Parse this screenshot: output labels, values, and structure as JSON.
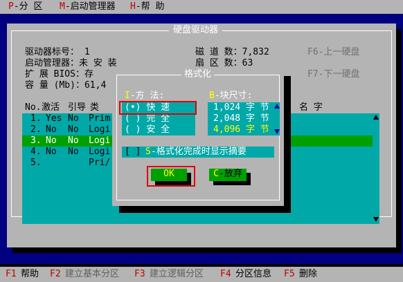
{
  "menu": {
    "items": [
      {
        "key": "P",
        "label": "-分  区"
      },
      {
        "key": "M",
        "label": "-启动管理器"
      },
      {
        "key": "H",
        "label": "-帮  助"
      }
    ]
  },
  "main_window": {
    "title": "硬盘驱动器",
    "info_left": [
      {
        "label": "驱动器标号",
        "value": "：  1"
      },
      {
        "label": "启动管理器",
        "value": "：未  安  装"
      },
      {
        "label": "扩 展 BIOS",
        "value": "：存"
      },
      {
        "label": "容 量 (Mb)",
        "value": "：61,4"
      }
    ],
    "info_right": [
      {
        "label": "磁 道 数",
        "value": "：7,832"
      },
      {
        "label": "扇 区 数",
        "value": "：63"
      }
    ],
    "buttons": [
      {
        "key": "F6",
        "label": "-上一硬盘"
      },
      {
        "key": "F7",
        "label": "-下一硬盘"
      }
    ],
    "table": {
      "headers": [
        "No.",
        "激活",
        "引导",
        "类",
        "名  字"
      ],
      "rows": [
        {
          "no": "1.",
          "active": "Yes",
          "boot": "No",
          "type": "Prim"
        },
        {
          "no": "2.",
          "active": "No",
          "boot": "No",
          "type": "Logi"
        },
        {
          "no": "3.",
          "active": "No",
          "boot": "No",
          "type": "Logi"
        },
        {
          "no": "4.",
          "active": "No",
          "boot": "No",
          "type": "Logi"
        },
        {
          "no": "5.",
          "active": "",
          "boot": "",
          "type": "Pri/"
        }
      ],
      "selected_row": 2
    }
  },
  "format_dialog": {
    "title": "格式化",
    "method_label_key": "I",
    "method_label": "-方  法:",
    "methods": [
      {
        "radio": "(•)",
        "label": "快  速",
        "selected": true
      },
      {
        "radio": "( )",
        "label": "完  全",
        "selected": false
      },
      {
        "radio": "( )",
        "label": "安  全",
        "selected": false
      }
    ],
    "block_label_key": "B",
    "block_label": "-块尺寸:",
    "block_sizes": [
      {
        "label": "1,024 字 节",
        "selected": false
      },
      {
        "label": "2,048 字 节",
        "selected": false
      },
      {
        "label": "4,096 字 节",
        "selected": true
      }
    ],
    "show_summary_checkbox": "[ ]",
    "show_summary_key": "S",
    "show_summary_label": "-格式化完成时显示摘要",
    "ok_key": "O",
    "ok_label": "K",
    "cancel_key": "C",
    "cancel_label": "-放弃"
  },
  "statusbar": {
    "items": [
      {
        "key": "F1",
        "label": "帮助",
        "dim": false
      },
      {
        "key": "F2",
        "label": "建立基本分区",
        "dim": true
      },
      {
        "key": "F3",
        "label": "建立逻辑分区",
        "dim": true
      },
      {
        "key": "F4",
        "label": "分区信息",
        "dim": false
      },
      {
        "key": "F5",
        "label": "删除",
        "dim": false
      }
    ]
  },
  "colors": {
    "background": "#000080",
    "window": "#b4b4b4",
    "panel": "#00a8a8",
    "selection": "#00a000",
    "hotkey": "#c00000",
    "highlight_box": "#e00000"
  }
}
